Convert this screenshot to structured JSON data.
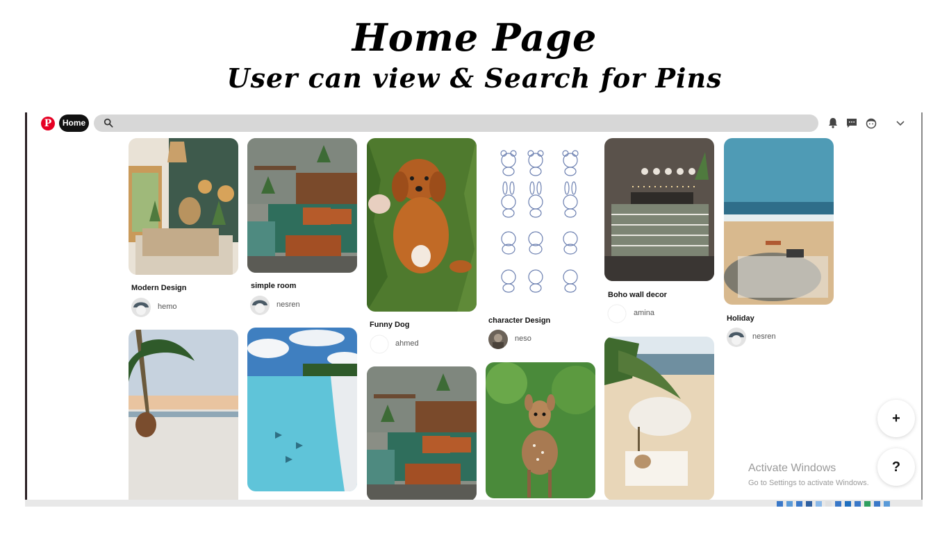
{
  "slide": {
    "title": "Home Page",
    "subtitle": "User can view & Search for Pins"
  },
  "header": {
    "logo_icon": "pinterest-logo-icon",
    "logo_letter": "P",
    "home_label": "Home",
    "search_placeholder": "",
    "icons": [
      "bell-icon",
      "message-icon",
      "profile-icon",
      "chevron-down-icon"
    ]
  },
  "pins": [
    {
      "title": "Modern Design",
      "user": "hemo",
      "image": "green bedroom with rattan decor"
    },
    {
      "title": "simple room",
      "user": "nesren",
      "image": "cozy bedroom with wooden wall"
    },
    {
      "title": "Funny Dog",
      "user": "ahmed",
      "image": "brown puppy on grass"
    },
    {
      "title": "character Design",
      "user": "neso",
      "image": "animal character sketches"
    },
    {
      "title": "Boho wall decor",
      "user": "amina",
      "image": "boho bedroom with moon phase wall decor"
    },
    {
      "title": "Holiday",
      "user": "nesren",
      "image": "beach with blanket and cushion"
    },
    {
      "title": "",
      "user": "",
      "image": "beach with palm tree and hanging chair"
    },
    {
      "title": "",
      "user": "",
      "image": "tropical turquoise water"
    },
    {
      "title": "",
      "user": "",
      "image": "cozy bedroom with wooden wall"
    },
    {
      "title": "",
      "user": "",
      "image": "baby deer in grass"
    },
    {
      "title": "",
      "user": "",
      "image": "beach with umbrella and palm"
    }
  ],
  "actions": {
    "add_label": "+",
    "help_label": "?"
  },
  "watermark": {
    "title": "Activate Windows",
    "subtitle": "Go to Settings to activate Windows."
  },
  "colors": {
    "brand": "#e60023",
    "home_button": "#111111",
    "search_bg": "#d7d7d7"
  }
}
